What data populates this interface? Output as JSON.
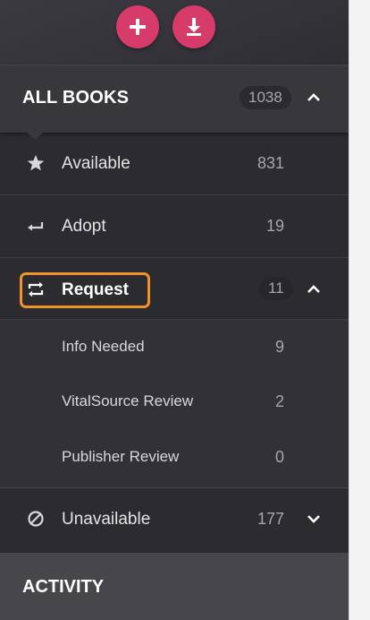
{
  "actions": {
    "add_icon": "plus-icon",
    "download_icon": "download-icon",
    "accent_color": "#d63b6a"
  },
  "all_books": {
    "title": "ALL BOOKS",
    "count": "1038"
  },
  "items": {
    "available": {
      "label": "Available",
      "count": "831",
      "icon": "star-icon"
    },
    "adopt": {
      "label": "Adopt",
      "count": "19",
      "icon": "return-arrow-icon"
    },
    "request": {
      "label": "Request",
      "count": "11",
      "icon": "repeat-icon",
      "highlight_color": "#f0932f",
      "subitems": [
        {
          "label": "Info Needed",
          "count": "9"
        },
        {
          "label": "VitalSource Review",
          "count": "2"
        },
        {
          "label": "Publisher Review",
          "count": "0"
        }
      ]
    },
    "unavailable": {
      "label": "Unavailable",
      "count": "177",
      "icon": "prohibited-icon"
    }
  },
  "activity": {
    "title": "ACTIVITY"
  }
}
